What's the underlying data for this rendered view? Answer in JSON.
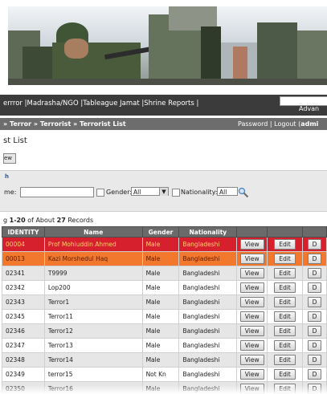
{
  "nav": {
    "links": "errror |Madrasha/NGO |Tableague Jamat |Shrine  Reports |",
    "advanced": "Advan"
  },
  "breadcrumb": {
    "path": "» Terror » Terrorist » Terrorist List",
    "user_links": "Password | Logout (",
    "user": "admi"
  },
  "page": {
    "title": "st List",
    "new_button": "ew"
  },
  "search": {
    "section_title": "h",
    "name_label": "me:",
    "name_value": "",
    "gender_label": "Gender:",
    "gender_value": "All",
    "nationality_label": "Nationality:",
    "nationality_value": "All"
  },
  "records": {
    "prefix": "g ",
    "range": "1-20",
    "mid": " of About ",
    "total": "27",
    "suffix": " Records"
  },
  "table": {
    "headers": [
      "IDENTITY",
      "Name",
      "Gender",
      "Nationality",
      "",
      "",
      ""
    ],
    "view_label": "View",
    "edit_label": "Edit",
    "del_label": "D",
    "rows": [
      {
        "id": "00004",
        "name": "Prof Mohiuddin Ahmed",
        "gender": "Male",
        "nationality": "Bangladeshi",
        "style": "red"
      },
      {
        "id": "00013",
        "name": "Kazi Morshedul Haq",
        "gender": "Male",
        "nationality": "Bangladeshi",
        "style": "orange"
      },
      {
        "id": "02341",
        "name": "T9999",
        "gender": "Male",
        "nationality": "Bangladeshi",
        "style": "gray"
      },
      {
        "id": "02342",
        "name": "Lop200",
        "gender": "Male",
        "nationality": "Bangladeshi",
        "style": "white"
      },
      {
        "id": "02343",
        "name": "Terror1",
        "gender": "Male",
        "nationality": "Bangladeshi",
        "style": "gray"
      },
      {
        "id": "02345",
        "name": "Terror11",
        "gender": "Male",
        "nationality": "Bangladeshi",
        "style": "white"
      },
      {
        "id": "02346",
        "name": "Terror12",
        "gender": "Male",
        "nationality": "Bangladeshi",
        "style": "gray"
      },
      {
        "id": "02347",
        "name": "Terror13",
        "gender": "Male",
        "nationality": "Bangladeshi",
        "style": "white"
      },
      {
        "id": "02348",
        "name": "Terror14",
        "gender": "Male",
        "nationality": "Bangladeshi",
        "style": "gray"
      },
      {
        "id": "02349",
        "name": "terror15",
        "gender": "Not Kn",
        "nationality": "Bangladeshi",
        "style": "white"
      },
      {
        "id": "02350",
        "name": "Terror16",
        "gender": "Male",
        "nationality": "Bangladeshi",
        "style": "gray"
      }
    ]
  },
  "colors": {
    "nav_bg": "#3b3b3b",
    "crumb_bg": "#6d6d6d",
    "header_bg": "#6a6a6a",
    "row_red": "#d7202e",
    "row_orange": "#f2782e"
  }
}
